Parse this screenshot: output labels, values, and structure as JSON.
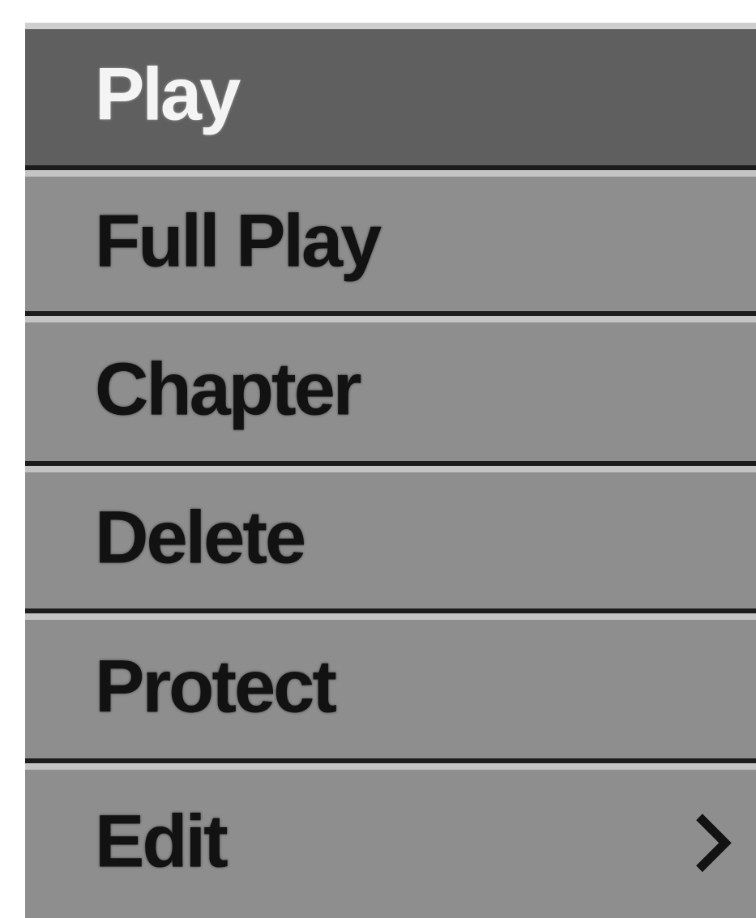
{
  "menu": {
    "items": [
      {
        "label": "Play",
        "selected": true
      },
      {
        "label": "Full Play",
        "selected": false
      },
      {
        "label": "Chapter",
        "selected": false
      },
      {
        "label": "Delete",
        "selected": false
      },
      {
        "label": "Protect",
        "selected": false
      },
      {
        "label": "Edit",
        "selected": false,
        "has_submenu": true,
        "submenu_icon": "chevron-right-icon"
      }
    ]
  },
  "colors": {
    "item_background": "#8e8e8e",
    "selected_background": "#5f5f5f",
    "item_text": "#121212",
    "selected_text": "#f4f4f4",
    "separator": "#1c1c1c",
    "highlight_edge": "#c4c4c4"
  }
}
